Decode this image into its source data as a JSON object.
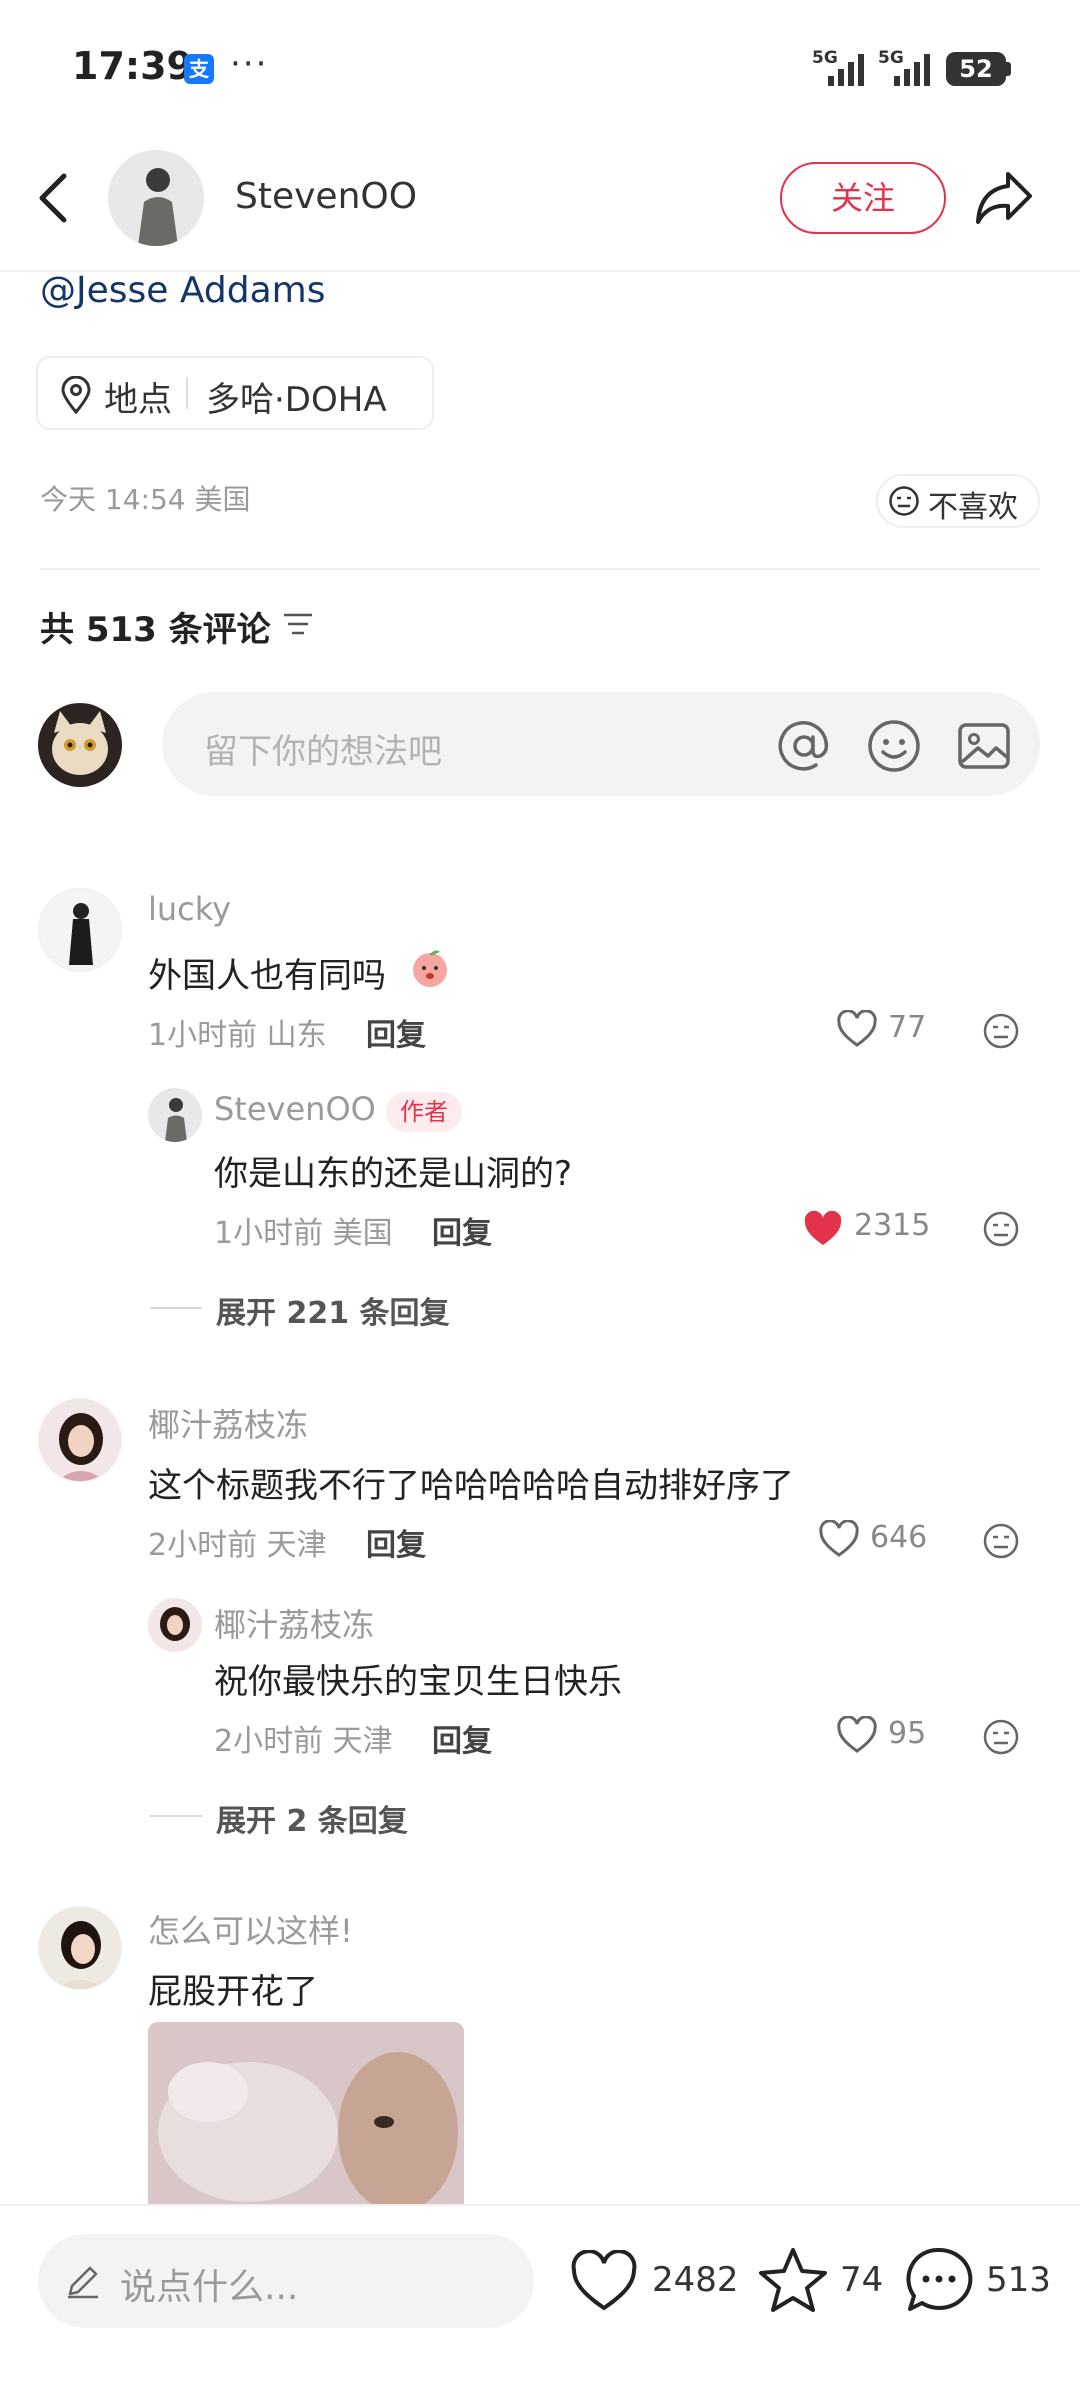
{
  "status_bar": {
    "time": "17:39",
    "alipay_glyph": "支",
    "more": "···",
    "signal1": "5G",
    "signal2": "5G",
    "battery": "52"
  },
  "header": {
    "author_name": "StevenOO",
    "follow_label": "关注"
  },
  "post": {
    "mention": "@Jesse Addams",
    "location_label": "地点",
    "location_place": "多哈·DOHA",
    "time": "今天 14:54 美国",
    "dislike_label": "不喜欢"
  },
  "comments_header": {
    "count_text": "共 513 条评论"
  },
  "comment_input": {
    "placeholder": "留下你的想法吧"
  },
  "comments": [
    {
      "user": "lucky",
      "text": "外国人也有同吗",
      "meta": "1小时前 山东",
      "reply": "回复",
      "likes": "77",
      "replies": [
        {
          "user": "StevenOO",
          "badge": "作者",
          "text": "你是山东的还是山洞的?",
          "meta": "1小时前 美国",
          "reply": "回复",
          "likes": "2315"
        }
      ],
      "expand": "展开 221 条回复"
    },
    {
      "user": "椰汁荔枝冻",
      "text": "这个标题我不行了哈哈哈哈哈自动排好序了",
      "meta": "2小时前 天津",
      "reply": "回复",
      "likes": "646",
      "replies": [
        {
          "user": "椰汁荔枝冻",
          "text": "祝你最快乐的宝贝生日快乐",
          "meta": "2小时前 天津",
          "reply": "回复",
          "likes": "95"
        }
      ],
      "expand": "展开 2 条回复"
    },
    {
      "user": "怎么可以这样!",
      "text": "屁股开花了"
    }
  ],
  "bottom_bar": {
    "placeholder": "说点什么...",
    "likes": "2482",
    "favorites": "74",
    "comments": "513"
  },
  "colors": {
    "accent": "#e2334b",
    "mention": "#133667",
    "muted": "#9a9a9a"
  }
}
